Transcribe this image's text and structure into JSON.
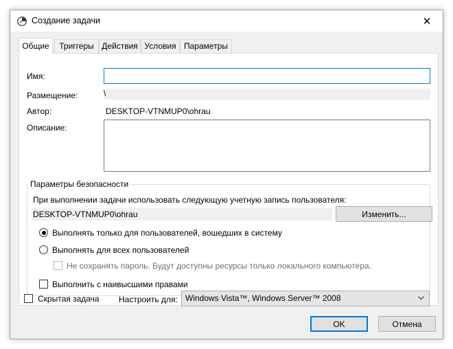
{
  "window": {
    "title": "Создание задачи",
    "close_glyph": "✕",
    "icon": "task-scheduler-clock-icon"
  },
  "tabs": [
    {
      "label": "Общие",
      "active": true
    },
    {
      "label": "Триггеры",
      "active": false
    },
    {
      "label": "Действия",
      "active": false
    },
    {
      "label": "Условия",
      "active": false
    },
    {
      "label": "Параметры",
      "active": false
    }
  ],
  "general": {
    "name_label": "Имя:",
    "name_value": "",
    "location_label": "Размещение:",
    "location_value": "\\",
    "author_label": "Автор:",
    "author_value": "DESKTOP-VTNMUP0\\ohrau",
    "description_label": "Описание:",
    "description_value": ""
  },
  "security": {
    "group_title": "Параметры безопасности",
    "account_prompt": "При выполнении задачи использовать следующую учетную запись пользователя:",
    "account_value": "DESKTOP-VTNMUP0\\ohrau",
    "change_button": "Изменить...",
    "radio_logged_on": "Выполнять только для пользователей, вошедших в систему",
    "radio_all_users": "Выполнять для всех пользователей",
    "no_store_password": "Не сохранять пароль. Будут доступны ресурсы только локального компьютера.",
    "highest_privileges": "Выполнить с наивысшими правами",
    "selected_radio": "logged_on"
  },
  "bottom": {
    "hidden_label": "Скрытая задача",
    "configure_label": "Настроить для:",
    "configure_value": "Windows Vista™, Windows Server™ 2008"
  },
  "buttons": {
    "ok": "OK",
    "cancel": "Отмена"
  },
  "colors": {
    "accent": "#0078d7",
    "window_bg": "#f0f0f0",
    "panel_bg": "#ffffff"
  }
}
